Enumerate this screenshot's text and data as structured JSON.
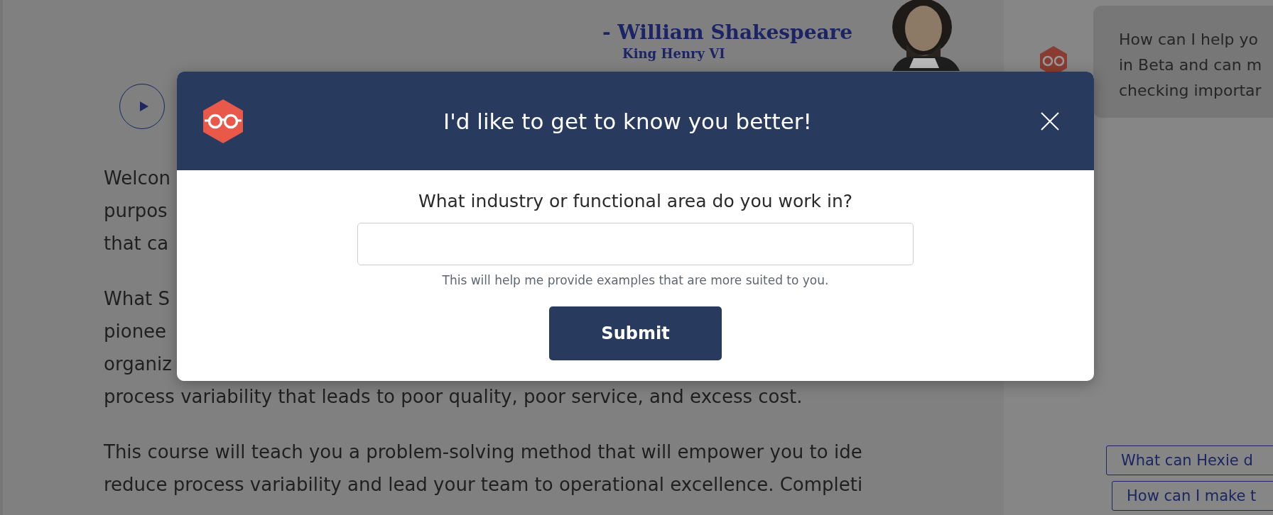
{
  "page": {
    "quote": {
      "author": "- William Shakespeare",
      "source": "King Henry VI"
    },
    "paragraphs": [
      {
        "lines": [
          "Welcon",
          "purpos",
          "that ca"
        ]
      },
      {
        "lines": [
          "What S",
          "pionee",
          "organiz",
          "process variability that leads to poor quality, poor service, and excess cost."
        ]
      },
      {
        "lines": [
          "This course will teach you a problem-solving method that will empower you to ide",
          "reduce process variability and lead your team to operational excellence. Completi"
        ]
      }
    ]
  },
  "assistant": {
    "message_lines": [
      "How can I help yo",
      "in Beta and can m",
      "checking importar"
    ],
    "suggestions": [
      "What can Hexie d",
      "How can I make t"
    ]
  },
  "modal": {
    "title": "I'd like to get to know you better!",
    "question": "What industry or functional area do you work in?",
    "hint": "This will help me provide examples that are more suited to you.",
    "submit": "Submit"
  }
}
